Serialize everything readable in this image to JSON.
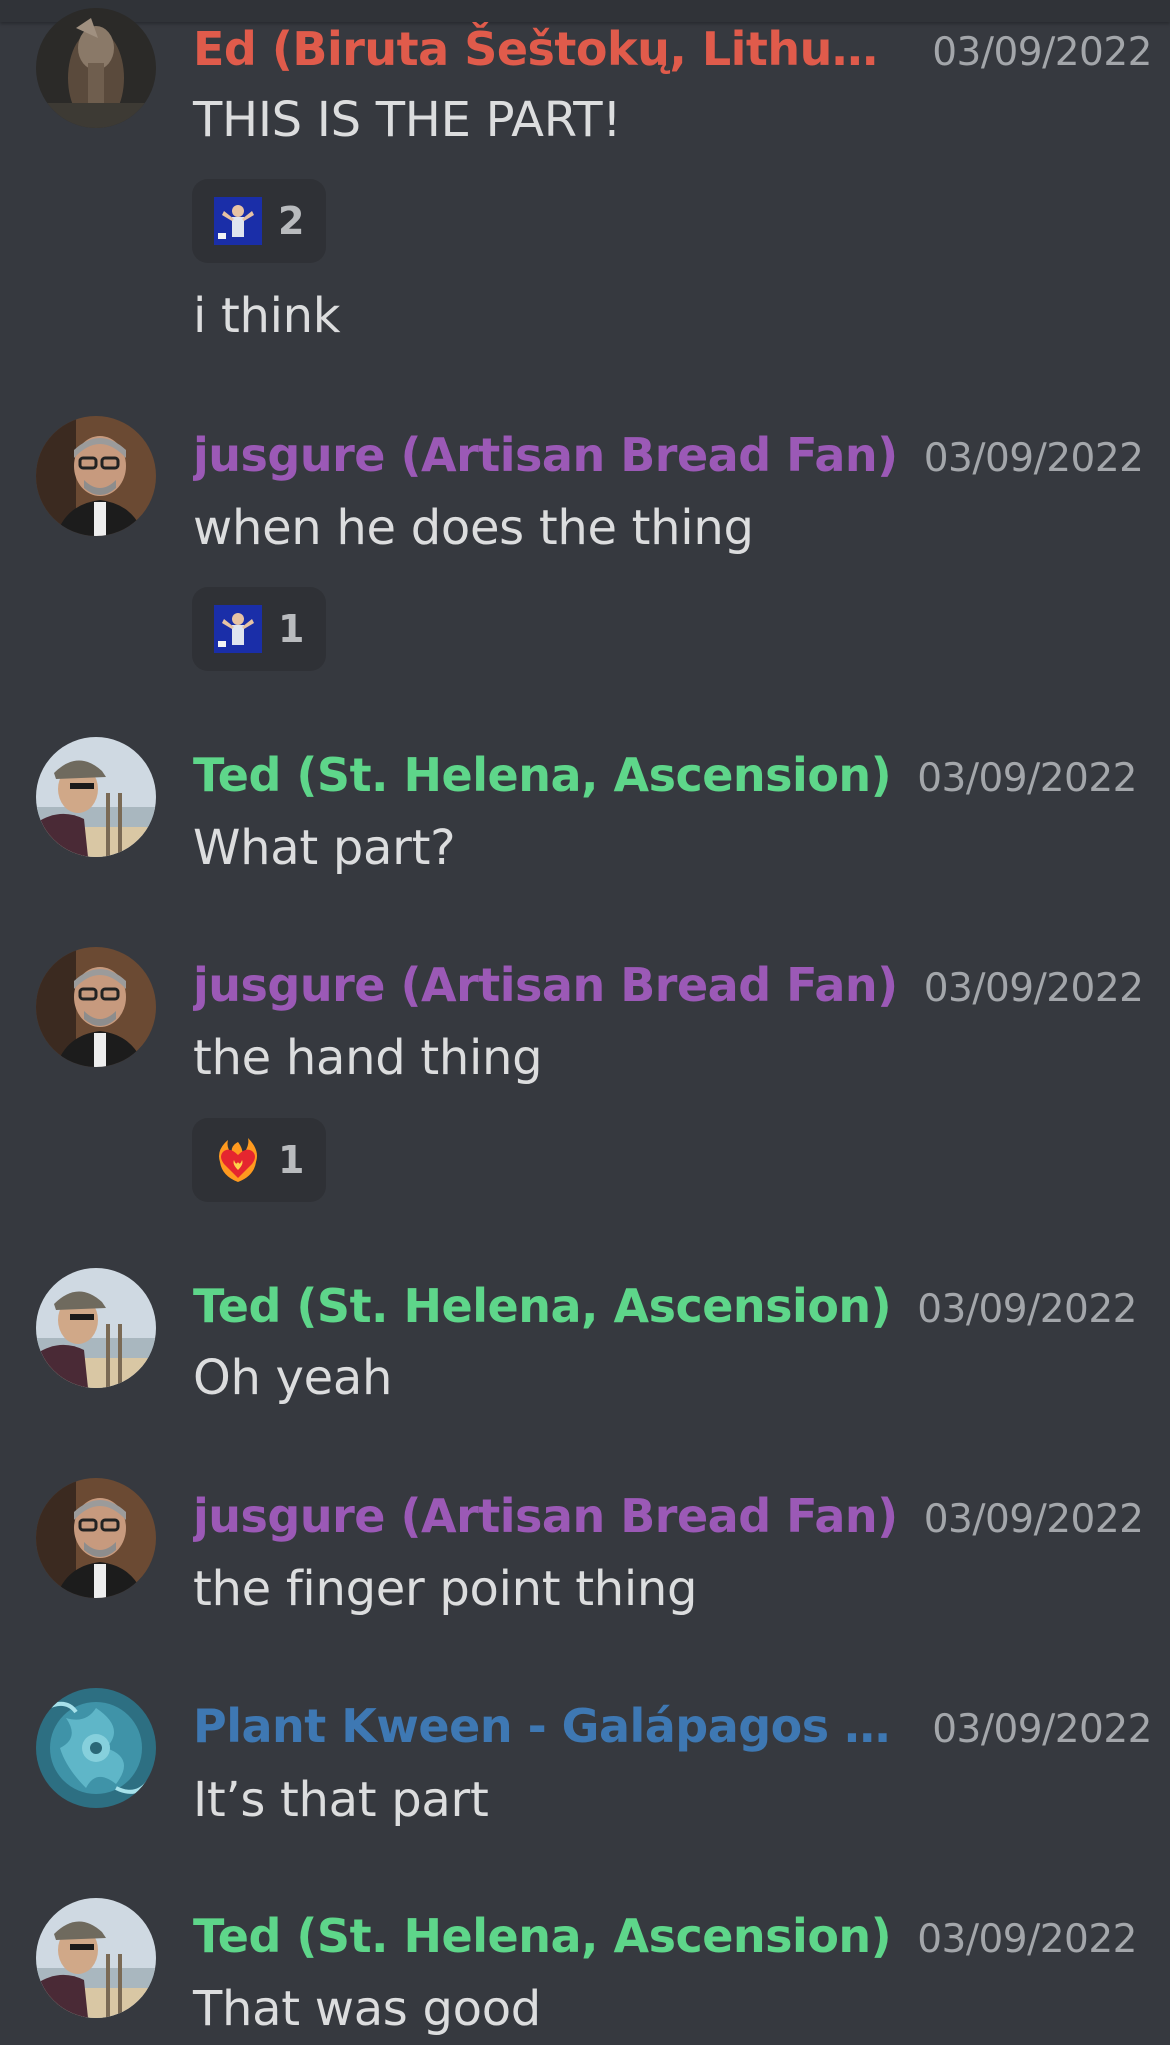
{
  "colors": {
    "background": "#36393f",
    "reaction_bg": "#2f3136",
    "text": "#dcddde",
    "timestamp": "#a3a6aa",
    "name_red": "#e05b4b",
    "name_purple": "#9b59b6",
    "name_green": "#5ed68a",
    "name_blue": "#3e78b3"
  },
  "messages": [
    {
      "author": "Ed (Biruta Šeštokų, Lithua...",
      "timestamp": "03/09/2022",
      "lines": [
        "THIS IS THE PART!",
        "i think"
      ],
      "reaction": {
        "emoji": "person-custom-emoji",
        "count": "2"
      }
    },
    {
      "author": "jusgure (Artisan Bread Fan)",
      "timestamp": "03/09/2022",
      "lines": [
        "when he does the thing"
      ],
      "reaction": {
        "emoji": "person-custom-emoji",
        "count": "1"
      }
    },
    {
      "author": "Ted (St. Helena, Ascension)",
      "timestamp": "03/09/2022",
      "lines": [
        "What part?"
      ]
    },
    {
      "author": "jusgure (Artisan Bread Fan)",
      "timestamp": "03/09/2022",
      "lines": [
        "the hand thing"
      ],
      "reaction": {
        "emoji": "heart-on-fire-emoji",
        "count": "1"
      }
    },
    {
      "author": "Ted (St. Helena, Ascension)",
      "timestamp": "03/09/2022",
      "lines": [
        "Oh yeah"
      ]
    },
    {
      "author": "jusgure (Artisan Bread Fan)",
      "timestamp": "03/09/2022",
      "lines": [
        "the finger point thing"
      ]
    },
    {
      "author": "Plant Kween - Galápagos I...",
      "timestamp": "03/09/2022",
      "lines": [
        "It’s that part"
      ]
    },
    {
      "author": "Ted (St. Helena, Ascension)",
      "timestamp": "03/09/2022",
      "lines": [
        "That was good"
      ]
    }
  ]
}
